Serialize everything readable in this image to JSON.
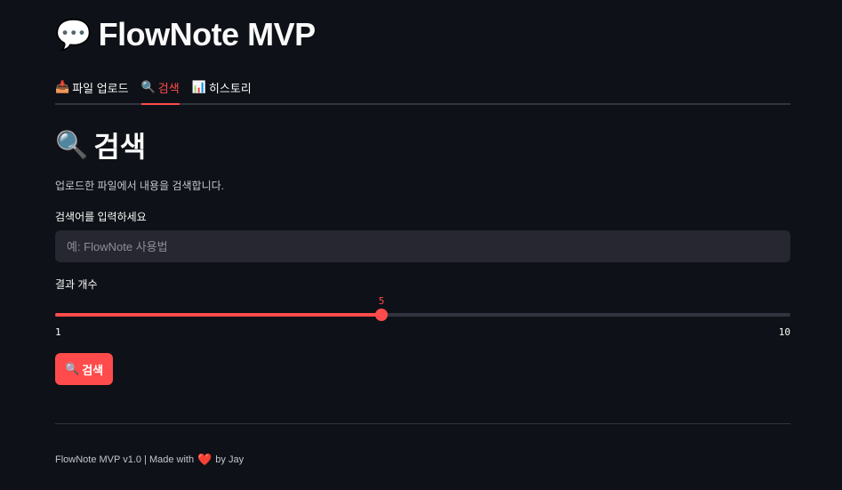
{
  "app": {
    "title": "FlowNote MVP",
    "title_icon": "speech-balloon-icon",
    "title_emoji": "💬"
  },
  "tabs": [
    {
      "label": "파일 업로드",
      "icon": "inbox-tray-icon",
      "emoji": "📥",
      "active": false
    },
    {
      "label": "검색",
      "icon": "magnifier-icon",
      "emoji": "🔍",
      "active": true
    },
    {
      "label": "히스토리",
      "icon": "bar-chart-icon",
      "emoji": "📊",
      "active": false
    }
  ],
  "search_page": {
    "title": "검색",
    "title_emoji": "🔍",
    "caption": "업로드한 파일에서 내용을 검색합니다.",
    "query_label": "검색어를 입력하세요",
    "query_value": "",
    "query_placeholder": "예: FlowNote 사용법",
    "count_label": "결과 개수",
    "slider": {
      "min": 1,
      "max": 10,
      "value": 5
    },
    "button_label": "검색",
    "button_emoji": "🔍"
  },
  "footer": {
    "prefix": "FlowNote MVP v1.0 | Made with",
    "heart": "❤️",
    "suffix": "by Jay"
  },
  "colors": {
    "background": "#0e1117",
    "accent": "#ff4b4b",
    "input_bg": "#262730",
    "track": "#31333f",
    "text": "#fafafa"
  }
}
